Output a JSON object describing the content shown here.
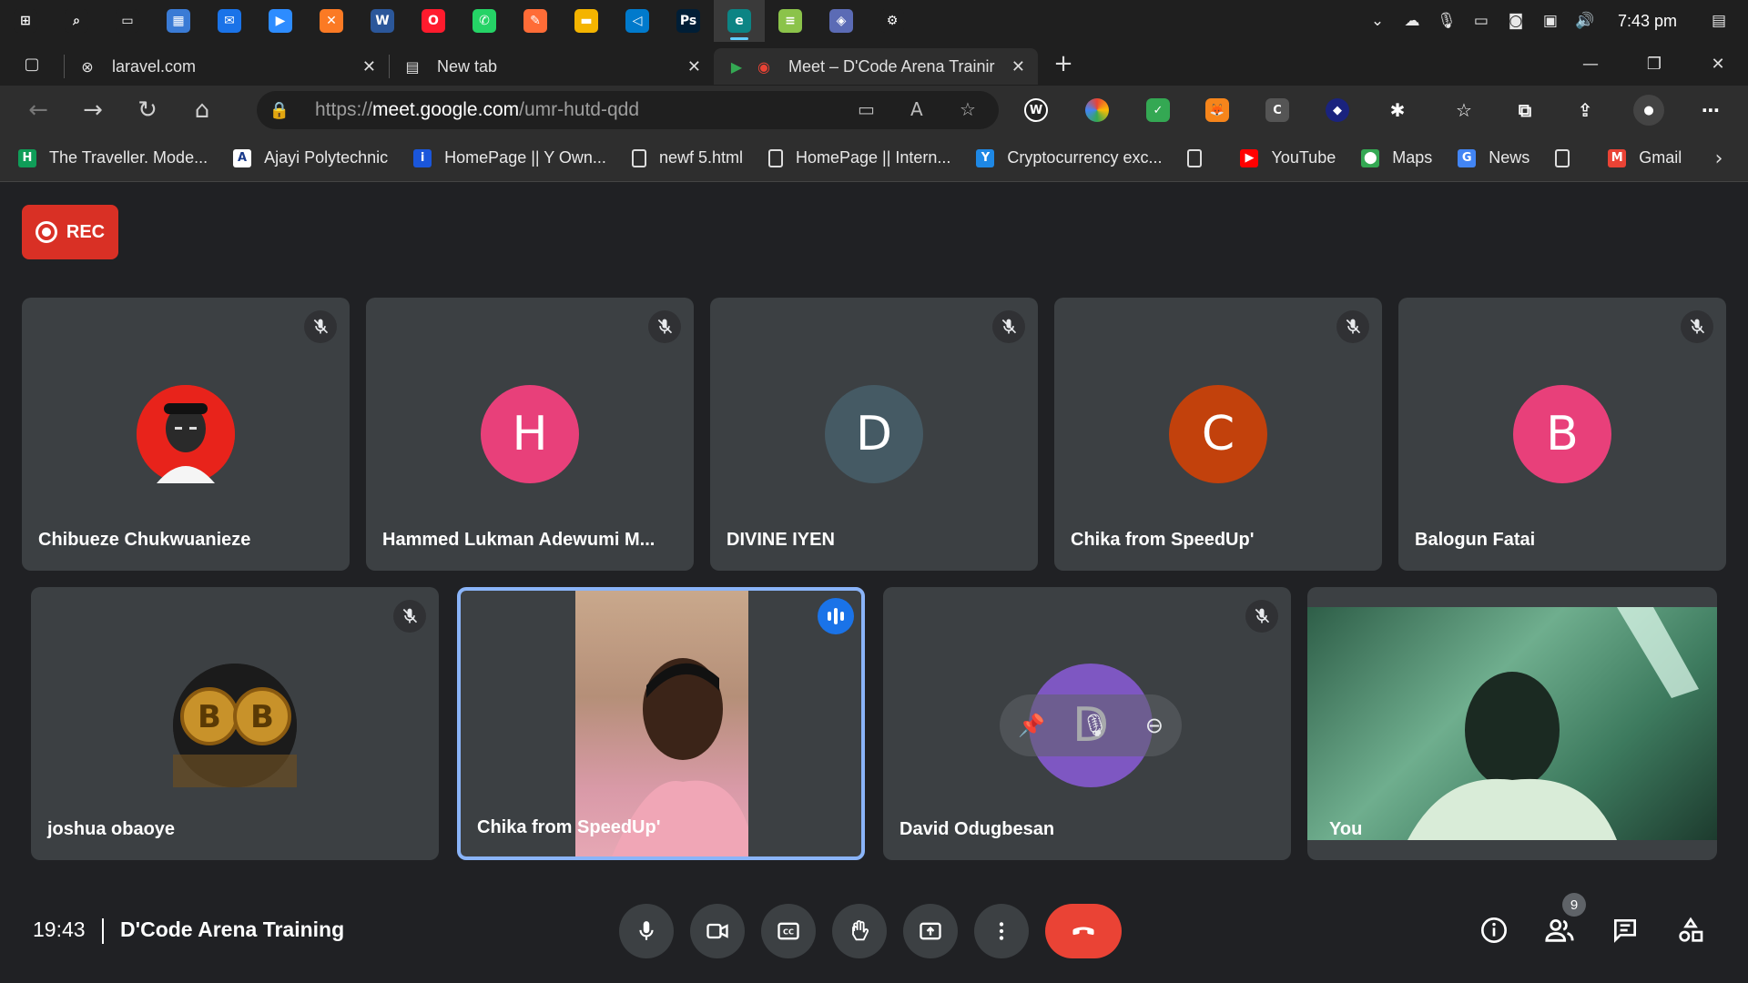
{
  "taskbar": {
    "apps": [
      {
        "icon": "windows-start-icon",
        "glyph": "⊞",
        "color": "#1f1f1f"
      },
      {
        "icon": "search-icon",
        "glyph": "⌕",
        "color": "#1f1f1f"
      },
      {
        "icon": "task-view-icon",
        "glyph": "▭",
        "color": "#1f1f1f"
      },
      {
        "icon": "store-icon",
        "glyph": "▦",
        "color": "#3a7bd5"
      },
      {
        "icon": "mail-icon",
        "glyph": "✉",
        "color": "#1a73e8"
      },
      {
        "icon": "zoom-icon",
        "glyph": "▶",
        "color": "#2d8cff"
      },
      {
        "icon": "xampp-icon",
        "glyph": "✕",
        "color": "#fb7a24"
      },
      {
        "icon": "word-icon",
        "glyph": "W",
        "color": "#2b579a"
      },
      {
        "icon": "opera-icon",
        "glyph": "O",
        "color": "#ff1b2d"
      },
      {
        "icon": "whatsapp-icon",
        "glyph": "✆",
        "color": "#25d366"
      },
      {
        "icon": "postman-icon",
        "glyph": "✎",
        "color": "#ff6c37"
      },
      {
        "icon": "file-explorer-icon",
        "glyph": "▬",
        "color": "#f4b400"
      },
      {
        "icon": "vscode-icon",
        "glyph": "◁",
        "color": "#007acc"
      },
      {
        "icon": "photoshop-icon",
        "glyph": "Ps",
        "color": "#001e36"
      },
      {
        "icon": "edge-icon",
        "glyph": "e",
        "color": "#0c8484"
      },
      {
        "icon": "notepad-icon",
        "glyph": "≡",
        "color": "#8bc34a"
      },
      {
        "icon": "app-icon",
        "glyph": "◈",
        "color": "#5b6bb5"
      },
      {
        "icon": "settings-icon",
        "glyph": "⚙",
        "color": "#1f1f1f"
      }
    ],
    "active_index": 14,
    "clock": "7:43 pm"
  },
  "tabs": [
    {
      "title": "laravel.com",
      "icon": "laravel-tab-icon",
      "glyph": "⊗"
    },
    {
      "title": "New tab",
      "icon": "new-tab-icon",
      "glyph": "▤"
    },
    {
      "title": "Meet – D'Code Arena Trainir",
      "icon": "meet-tab-icon",
      "glyph": "◉"
    }
  ],
  "address": {
    "url_prefix": "https://",
    "url_host": "meet.google.com",
    "url_path": "/umr-hutd-qdd"
  },
  "bookmarks": [
    {
      "label": "The Traveller. Mode...",
      "icon": "h-bookmark-icon",
      "glyph": "H",
      "color": "#0f9d58"
    },
    {
      "label": "Ajayi Polytechnic",
      "icon": "ajayi-bookmark-icon",
      "glyph": "A",
      "color": "#ffffff"
    },
    {
      "label": "HomePage || Y Own...",
      "icon": "info-bookmark-icon",
      "glyph": "i",
      "color": "#1a56db"
    },
    {
      "label": "newf 5.html",
      "icon": "file-bookmark-icon",
      "glyph": "▯",
      "color": "#2e2e2e"
    },
    {
      "label": "HomePage || Intern...",
      "icon": "file-bookmark-icon",
      "glyph": "▯",
      "color": "#2e2e2e"
    },
    {
      "label": "Cryptocurrency exc...",
      "icon": "crypto-bookmark-icon",
      "glyph": "Y",
      "color": "#1e88e5"
    },
    {
      "label": "",
      "icon": "file-bookmark-icon",
      "glyph": "▯",
      "color": "#2e2e2e"
    },
    {
      "label": "YouTube",
      "icon": "youtube-icon",
      "glyph": "▶",
      "color": "#ff0000"
    },
    {
      "label": "Maps",
      "icon": "maps-icon",
      "glyph": "⬤",
      "color": "#34a853"
    },
    {
      "label": "News",
      "icon": "news-icon",
      "glyph": "G",
      "color": "#4285f4"
    },
    {
      "label": "",
      "icon": "file-bookmark-icon",
      "glyph": "▯",
      "color": "#2e2e2e"
    },
    {
      "label": "Gmail",
      "icon": "gmail-icon",
      "glyph": "M",
      "color": "#ea4335"
    }
  ],
  "meet": {
    "rec_label": "REC",
    "participants_row1": [
      {
        "name": "Chibueze Chukwuanieze",
        "initial": "",
        "color": "#e8231b",
        "photo": true
      },
      {
        "name": "Hammed Lukman Adewumi M...",
        "initial": "H",
        "color": "#e8407a"
      },
      {
        "name": "DIVINE IYEN",
        "initial": "D",
        "color": "#455a64"
      },
      {
        "name": "Chika from SpeedUp'",
        "initial": "C",
        "color": "#c2410c"
      },
      {
        "name": "Balogun Fatai",
        "initial": "B",
        "color": "#e8407a"
      }
    ],
    "participants_row2": [
      {
        "name": "joshua obaoye",
        "avatar": "bitcoin"
      },
      {
        "name": "Chika from SpeedUp'",
        "avatar": "video",
        "speaking": true
      },
      {
        "name": "David Odugbesan",
        "initial": "D",
        "color": "#7e57c2"
      },
      {
        "name": "You",
        "avatar": "self-video"
      }
    ],
    "meeting_time": "19:43",
    "meeting_title": "D'Code Arena Training",
    "people_count": "9"
  }
}
